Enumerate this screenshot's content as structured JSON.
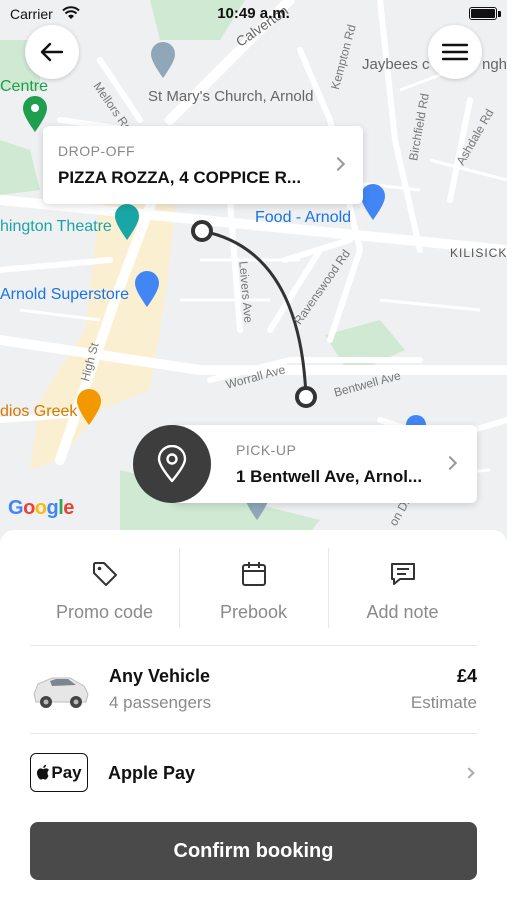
{
  "status_bar": {
    "carrier": "Carrier",
    "time": "10:49 a.m.",
    "battery_level": 1.0
  },
  "map": {
    "labels": {
      "calverton": "Calverton",
      "centre": "Centre",
      "st_marys": "St Mary's Church, Arnold",
      "jaybees": "Jaybees c",
      "jaybees_tail": "ngh",
      "mellors": "Mellors Rd",
      "kempton": "Kempton Rd",
      "birchfield": "Birchfield Rd",
      "ashdale": "Ashdale Rd",
      "theatre": "hington Theatre",
      "food": "Food - Arnold",
      "kilisick": "KILISICK",
      "superstore": "Arnold Superstore",
      "leivers": "Leivers Ave",
      "ravenswood": "Ravenswood Rd",
      "high_st": "High St",
      "worrall": "Worrall Ave",
      "bentwell": "Bentwell Ave",
      "greek": "dios Greek",
      "dr": "on Dr",
      "google": "Google"
    },
    "accent_route": "#333333",
    "accent_blue": "#1a73e8"
  },
  "dropoff": {
    "type": "DROP-OFF",
    "address": "PIZZA ROZZA, 4 COPPICE R..."
  },
  "pickup": {
    "type": "PICK-UP",
    "address": "1 Bentwell Ave, Arnol..."
  },
  "actions": [
    {
      "label": "Promo code",
      "icon": "tag-icon"
    },
    {
      "label": "Prebook",
      "icon": "calendar-icon"
    },
    {
      "label": "Add note",
      "icon": "message-icon"
    }
  ],
  "vehicle": {
    "name": "Any Vehicle",
    "passengers": "4 passengers",
    "price": "£4",
    "estimate": "Estimate"
  },
  "payment": {
    "badge": "Pay",
    "name": "Apple Pay"
  },
  "confirm_label": "Confirm booking",
  "colors": {
    "button": "#4a4a4a",
    "muted_text": "#8a8a8a"
  }
}
